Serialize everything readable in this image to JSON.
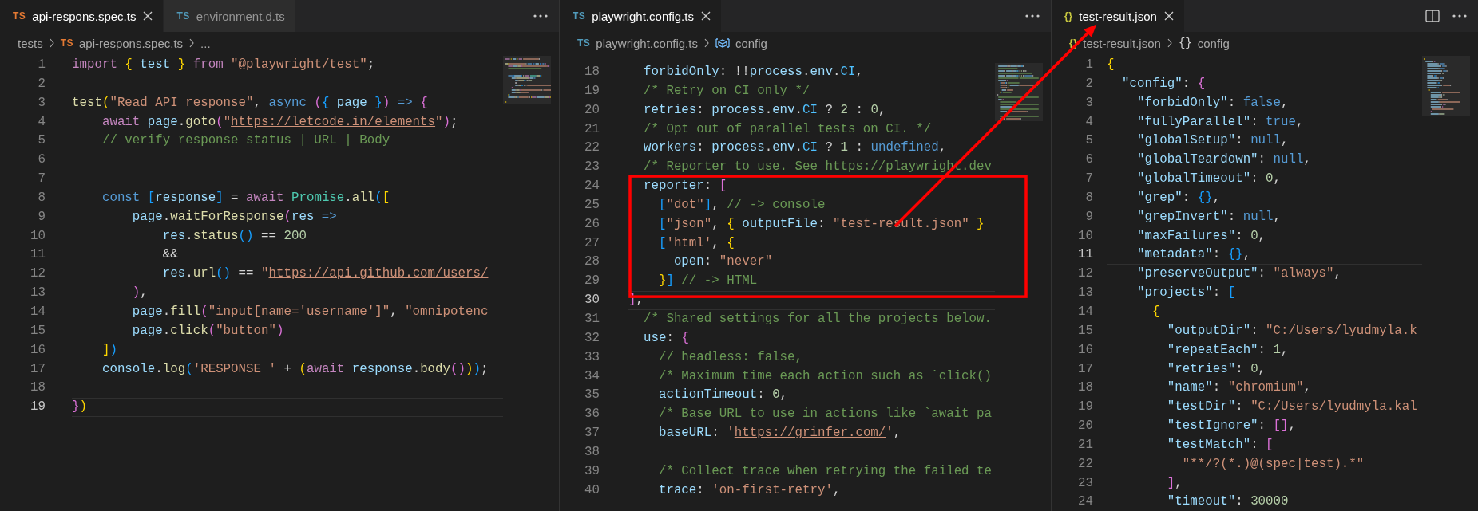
{
  "panes": [
    {
      "tabs": [
        {
          "label": "api-respons.spec.ts",
          "icon": "TS",
          "color": "#e37933",
          "selected": true
        },
        {
          "label": "environment.d.ts",
          "icon": "TS",
          "color": "#519aba",
          "selected": false
        }
      ],
      "actions": [
        {
          "kind": "more"
        }
      ],
      "breadcrumbs": [
        {
          "kind": "folder",
          "label": "tests"
        },
        {
          "kind": "file",
          "icon": "TS",
          "color": "#e37933",
          "label": "api-respons.spec.ts"
        },
        {
          "kind": "more",
          "label": "..."
        }
      ],
      "lines": [
        {
          "n": "1",
          "current": false,
          "tokens": [
            {
              "text": "import",
              "kind": "c"
            },
            {
              "text": " {",
              "kind": "b1"
            },
            {
              "text": " test ",
              "kind": "v"
            },
            {
              "text": "}",
              "kind": "b1"
            },
            {
              "text": " from",
              "kind": "c"
            },
            {
              "text": " \"@playwright/test\"",
              "kind": "s"
            },
            {
              "text": ";",
              "kind": "p"
            }
          ]
        },
        {
          "n": "2",
          "current": false
        },
        {
          "n": "3",
          "current": false,
          "tokens": [
            {
              "text": "test",
              "kind": "f"
            },
            {
              "text": "(",
              "kind": "b1"
            },
            {
              "text": "\"Read API response\"",
              "kind": "s"
            },
            {
              "text": ", ",
              "kind": "p"
            },
            {
              "text": "async",
              "kind": "k"
            },
            {
              "text": " (",
              "kind": "b2"
            },
            {
              "text": "{",
              "kind": "b3"
            },
            {
              "text": " page ",
              "kind": "v"
            },
            {
              "text": "}",
              "kind": "b3"
            },
            {
              "text": ")",
              "kind": "b2"
            },
            {
              "text": " => ",
              "kind": "k"
            },
            {
              "text": "{",
              "kind": "b2"
            }
          ]
        },
        {
          "n": "4",
          "current": false,
          "tokens": [
            {
              "text": "    await",
              "kind": "c"
            },
            {
              "text": " page",
              "kind": "v"
            },
            {
              "text": ".",
              "kind": "p"
            },
            {
              "text": "goto",
              "kind": "f"
            },
            {
              "text": "(",
              "kind": "b2"
            },
            {
              "text": "\"",
              "kind": "s"
            },
            {
              "text": "https://letcode.in/elements",
              "kind": "u"
            },
            {
              "text": "\"",
              "kind": "s"
            },
            {
              "text": ")",
              "kind": "b2"
            },
            {
              "text": ";",
              "kind": "p"
            }
          ]
        },
        {
          "n": "5",
          "current": false,
          "tokens": [
            {
              "text": "    // verify response status | URL | Body",
              "kind": "m"
            }
          ]
        },
        {
          "n": "6",
          "current": false
        },
        {
          "n": "7",
          "current": false
        },
        {
          "n": "8",
          "current": false,
          "tokens": [
            {
              "text": "    const",
              "kind": "k"
            },
            {
              "text": " [",
              "kind": "b3"
            },
            {
              "text": "response",
              "kind": "v"
            },
            {
              "text": "]",
              "kind": "b3"
            },
            {
              "text": " = ",
              "kind": "p"
            },
            {
              "text": "await",
              "kind": "c"
            },
            {
              "text": " Promise",
              "kind": "t"
            },
            {
              "text": ".",
              "kind": "p"
            },
            {
              "text": "all",
              "kind": "f"
            },
            {
              "text": "(",
              "kind": "b3"
            },
            {
              "text": "[",
              "kind": "b1"
            }
          ]
        },
        {
          "n": "9",
          "current": false,
          "tokens": [
            {
              "text": "        page",
              "kind": "v"
            },
            {
              "text": ".",
              "kind": "p"
            },
            {
              "text": "waitForResponse",
              "kind": "f"
            },
            {
              "text": "(",
              "kind": "b2"
            },
            {
              "text": "res",
              "kind": "v"
            },
            {
              "text": " =>",
              "kind": "k"
            }
          ]
        },
        {
          "n": "10",
          "current": false,
          "tokens": [
            {
              "text": "            res",
              "kind": "v"
            },
            {
              "text": ".",
              "kind": "p"
            },
            {
              "text": "status",
              "kind": "f"
            },
            {
              "text": "()",
              "kind": "b3"
            },
            {
              "text": " == ",
              "kind": "p"
            },
            {
              "text": "200",
              "kind": "n"
            }
          ]
        },
        {
          "n": "11",
          "current": false,
          "tokens": [
            {
              "text": "            &&",
              "kind": "p"
            }
          ]
        },
        {
          "n": "12",
          "current": false,
          "tokens": [
            {
              "text": "            res",
              "kind": "v"
            },
            {
              "text": ".",
              "kind": "p"
            },
            {
              "text": "url",
              "kind": "f"
            },
            {
              "text": "()",
              "kind": "b3"
            },
            {
              "text": " == ",
              "kind": "p"
            },
            {
              "text": "\"",
              "kind": "s"
            },
            {
              "text": "https://api.github.com/users/",
              "kind": "u"
            }
          ]
        },
        {
          "n": "13",
          "current": false,
          "tokens": [
            {
              "text": "        )",
              "kind": "b2"
            },
            {
              "text": ",",
              "kind": "p"
            }
          ]
        },
        {
          "n": "14",
          "current": false,
          "tokens": [
            {
              "text": "        page",
              "kind": "v"
            },
            {
              "text": ".",
              "kind": "p"
            },
            {
              "text": "fill",
              "kind": "f"
            },
            {
              "text": "(",
              "kind": "b2"
            },
            {
              "text": "\"input[name='username']\"",
              "kind": "s"
            },
            {
              "text": ", ",
              "kind": "p"
            },
            {
              "text": "\"omnipotenc",
              "kind": "s"
            }
          ]
        },
        {
          "n": "15",
          "current": false,
          "tokens": [
            {
              "text": "        page",
              "kind": "v"
            },
            {
              "text": ".",
              "kind": "p"
            },
            {
              "text": "click",
              "kind": "f"
            },
            {
              "text": "(",
              "kind": "b2"
            },
            {
              "text": "\"button\"",
              "kind": "s"
            },
            {
              "text": ")",
              "kind": "b2"
            }
          ]
        },
        {
          "n": "16",
          "current": false,
          "tokens": [
            {
              "text": "    ]",
              "kind": "b1"
            },
            {
              "text": ")",
              "kind": "b3"
            }
          ]
        },
        {
          "n": "17",
          "current": false,
          "tokens": [
            {
              "text": "    console",
              "kind": "v"
            },
            {
              "text": ".",
              "kind": "p"
            },
            {
              "text": "log",
              "kind": "f"
            },
            {
              "text": "(",
              "kind": "b3"
            },
            {
              "text": "'RESPONSE '",
              "kind": "s"
            },
            {
              "text": " + ",
              "kind": "p"
            },
            {
              "text": "(",
              "kind": "b1"
            },
            {
              "text": "await",
              "kind": "c"
            },
            {
              "text": " response",
              "kind": "v"
            },
            {
              "text": ".",
              "kind": "p"
            },
            {
              "text": "body",
              "kind": "f"
            },
            {
              "text": "()",
              "kind": "b2"
            },
            {
              "text": ")",
              "kind": "b1"
            },
            {
              "text": ")",
              "kind": "b3"
            },
            {
              "text": ";",
              "kind": "p"
            }
          ]
        },
        {
          "n": "18",
          "current": false
        },
        {
          "n": "19",
          "current": true,
          "tokens": [
            {
              "text": "}",
              "kind": "b2"
            },
            {
              "text": ")",
              "kind": "b1"
            }
          ]
        }
      ]
    },
    {
      "tabs": [
        {
          "label": "playwright.config.ts",
          "icon": "TS",
          "color": "#519aba",
          "selected": true
        }
      ],
      "actions": [
        {
          "kind": "more"
        }
      ],
      "breadcrumbs": [
        {
          "kind": "file",
          "icon": "TS",
          "color": "#519aba",
          "label": "playwright.config.ts"
        },
        {
          "kind": "symbol",
          "label": "config"
        }
      ],
      "lines": [
        {
          "n": "18",
          "current": false,
          "tokens": [
            {
              "text": "  forbidOnly",
              "kind": "v"
            },
            {
              "text": ": !!",
              "kind": "p"
            },
            {
              "text": "process",
              "kind": "v"
            },
            {
              "text": ".",
              "kind": "p"
            },
            {
              "text": "env",
              "kind": "v"
            },
            {
              "text": ".",
              "kind": "p"
            },
            {
              "text": "CI",
              "kind": "C"
            },
            {
              "text": ",",
              "kind": "p"
            }
          ]
        },
        {
          "n": "19",
          "current": false,
          "tokens": [
            {
              "text": "  /* Retry on CI only */",
              "kind": "m"
            }
          ]
        },
        {
          "n": "20",
          "current": false,
          "tokens": [
            {
              "text": "  retries",
              "kind": "v"
            },
            {
              "text": ": ",
              "kind": "p"
            },
            {
              "text": "process",
              "kind": "v"
            },
            {
              "text": ".",
              "kind": "p"
            },
            {
              "text": "env",
              "kind": "v"
            },
            {
              "text": ".",
              "kind": "p"
            },
            {
              "text": "CI",
              "kind": "C"
            },
            {
              "text": " ? ",
              "kind": "p"
            },
            {
              "text": "2",
              "kind": "n"
            },
            {
              "text": " : ",
              "kind": "p"
            },
            {
              "text": "0",
              "kind": "n"
            },
            {
              "text": ",",
              "kind": "p"
            }
          ]
        },
        {
          "n": "21",
          "current": false,
          "tokens": [
            {
              "text": "  /* Opt out of parallel tests on CI. */",
              "kind": "m"
            }
          ]
        },
        {
          "n": "22",
          "current": false,
          "tokens": [
            {
              "text": "  workers",
              "kind": "v"
            },
            {
              "text": ": ",
              "kind": "p"
            },
            {
              "text": "process",
              "kind": "v"
            },
            {
              "text": ".",
              "kind": "p"
            },
            {
              "text": "env",
              "kind": "v"
            },
            {
              "text": ".",
              "kind": "p"
            },
            {
              "text": "CI",
              "kind": "C"
            },
            {
              "text": " ? ",
              "kind": "p"
            },
            {
              "text": "1",
              "kind": "n"
            },
            {
              "text": " : ",
              "kind": "p"
            },
            {
              "text": "undefined",
              "kind": "k"
            },
            {
              "text": ",",
              "kind": "p"
            }
          ]
        },
        {
          "n": "23",
          "current": false,
          "tokens": [
            {
              "text": "  /* Reporter to use. See ",
              "kind": "m"
            },
            {
              "text": "https://playwright.dev",
              "kind": "mu"
            }
          ]
        },
        {
          "n": "24",
          "current": false,
          "tokens": [
            {
              "text": "  reporter",
              "kind": "v"
            },
            {
              "text": ": ",
              "kind": "p"
            },
            {
              "text": "[",
              "kind": "b2"
            }
          ]
        },
        {
          "n": "25",
          "current": false,
          "tokens": [
            {
              "text": "    [",
              "kind": "b3"
            },
            {
              "text": "\"dot\"",
              "kind": "s"
            },
            {
              "text": "]",
              "kind": "b3"
            },
            {
              "text": ", ",
              "kind": "p"
            },
            {
              "text": "// -> console",
              "kind": "m"
            }
          ]
        },
        {
          "n": "26",
          "current": false,
          "tokens": [
            {
              "text": "    [",
              "kind": "b3"
            },
            {
              "text": "\"json\"",
              "kind": "s"
            },
            {
              "text": ", ",
              "kind": "p"
            },
            {
              "text": "{",
              "kind": "b1"
            },
            {
              "text": " outputFile",
              "kind": "v"
            },
            {
              "text": ": ",
              "kind": "p"
            },
            {
              "text": "\"test-result.json\"",
              "kind": "s"
            },
            {
              "text": " }",
              "kind": "b1"
            }
          ]
        },
        {
          "n": "27",
          "current": false,
          "tokens": [
            {
              "text": "    [",
              "kind": "b3"
            },
            {
              "text": "'html'",
              "kind": "s"
            },
            {
              "text": ", ",
              "kind": "p"
            },
            {
              "text": "{",
              "kind": "b1"
            }
          ]
        },
        {
          "n": "28",
          "current": false,
          "tokens": [
            {
              "text": "      open",
              "kind": "v"
            },
            {
              "text": ": ",
              "kind": "p"
            },
            {
              "text": "\"never\"",
              "kind": "s"
            }
          ]
        },
        {
          "n": "29",
          "current": false,
          "tokens": [
            {
              "text": "    }",
              "kind": "b1"
            },
            {
              "text": "]",
              "kind": "b3"
            },
            {
              "text": " // -> HTML",
              "kind": "m"
            }
          ]
        },
        {
          "n": "30",
          "current": true,
          "tokens": [
            {
              "text": "]",
              "kind": "b2"
            },
            {
              "text": ",",
              "kind": "p"
            }
          ]
        },
        {
          "n": "31",
          "current": false,
          "tokens": [
            {
              "text": "  /* Shared settings for all the projects below.",
              "kind": "m"
            }
          ]
        },
        {
          "n": "32",
          "current": false,
          "tokens": [
            {
              "text": "  use",
              "kind": "v"
            },
            {
              "text": ": ",
              "kind": "p"
            },
            {
              "text": "{",
              "kind": "b2"
            }
          ]
        },
        {
          "n": "33",
          "current": false,
          "tokens": [
            {
              "text": "    // headless: false,",
              "kind": "m"
            }
          ]
        },
        {
          "n": "34",
          "current": false,
          "tokens": [
            {
              "text": "    /* Maximum time each action such as `click()",
              "kind": "m"
            }
          ]
        },
        {
          "n": "35",
          "current": false,
          "tokens": [
            {
              "text": "    actionTimeout",
              "kind": "v"
            },
            {
              "text": ": ",
              "kind": "p"
            },
            {
              "text": "0",
              "kind": "n"
            },
            {
              "text": ",",
              "kind": "p"
            }
          ]
        },
        {
          "n": "36",
          "current": false,
          "tokens": [
            {
              "text": "    /* Base URL to use in actions like `await pa",
              "kind": "m"
            }
          ]
        },
        {
          "n": "37",
          "current": false,
          "tokens": [
            {
              "text": "    baseURL",
              "kind": "v"
            },
            {
              "text": ": ",
              "kind": "p"
            },
            {
              "text": "'",
              "kind": "s"
            },
            {
              "text": "https://grinfer.com/",
              "kind": "u"
            },
            {
              "text": "'",
              "kind": "s"
            },
            {
              "text": ",",
              "kind": "p"
            }
          ]
        },
        {
          "n": "38",
          "current": false
        },
        {
          "n": "39",
          "current": false,
          "tokens": [
            {
              "text": "    /* Collect trace when retrying the failed te",
              "kind": "m"
            }
          ]
        },
        {
          "n": "40",
          "current": false,
          "tokens": [
            {
              "text": "    trace",
              "kind": "v"
            },
            {
              "text": ": ",
              "kind": "p"
            },
            {
              "text": "'on-first-retry'",
              "kind": "s"
            },
            {
              "text": ",",
              "kind": "p"
            }
          ]
        }
      ]
    },
    {
      "tabs": [
        {
          "label": "test-result.json",
          "icon": "{}",
          "color": "#cbcb41",
          "selected": true
        }
      ],
      "actions": [
        {
          "kind": "split"
        },
        {
          "kind": "more"
        }
      ],
      "breadcrumbs": [
        {
          "kind": "file",
          "icon": "{}",
          "color": "#cbcb41",
          "label": "test-result.json"
        },
        {
          "kind": "object",
          "icon": "{}",
          "label": "config"
        }
      ],
      "lines": [
        {
          "n": "1",
          "current": false,
          "tokens": [
            {
              "text": "{",
              "kind": "b1"
            }
          ]
        },
        {
          "n": "2",
          "current": false,
          "tokens": [
            {
              "text": "  \"config\"",
              "kind": "v"
            },
            {
              "text": ": ",
              "kind": "p"
            },
            {
              "text": "{",
              "kind": "b2"
            }
          ]
        },
        {
          "n": "3",
          "current": false,
          "tokens": [
            {
              "text": "    \"forbidOnly\"",
              "kind": "v"
            },
            {
              "text": ": ",
              "kind": "p"
            },
            {
              "text": "false",
              "kind": "k"
            },
            {
              "text": ",",
              "kind": "p"
            }
          ]
        },
        {
          "n": "4",
          "current": false,
          "tokens": [
            {
              "text": "    \"fullyParallel\"",
              "kind": "v"
            },
            {
              "text": ": ",
              "kind": "p"
            },
            {
              "text": "true",
              "kind": "k"
            },
            {
              "text": ",",
              "kind": "p"
            }
          ]
        },
        {
          "n": "5",
          "current": false,
          "tokens": [
            {
              "text": "    \"globalSetup\"",
              "kind": "v"
            },
            {
              "text": ": ",
              "kind": "p"
            },
            {
              "text": "null",
              "kind": "k"
            },
            {
              "text": ",",
              "kind": "p"
            }
          ]
        },
        {
          "n": "6",
          "current": false,
          "tokens": [
            {
              "text": "    \"globalTeardown\"",
              "kind": "v"
            },
            {
              "text": ": ",
              "kind": "p"
            },
            {
              "text": "null",
              "kind": "k"
            },
            {
              "text": ",",
              "kind": "p"
            }
          ]
        },
        {
          "n": "7",
          "current": false,
          "tokens": [
            {
              "text": "    \"globalTimeout\"",
              "kind": "v"
            },
            {
              "text": ": ",
              "kind": "p"
            },
            {
              "text": "0",
              "kind": "n"
            },
            {
              "text": ",",
              "kind": "p"
            }
          ]
        },
        {
          "n": "8",
          "current": false,
          "tokens": [
            {
              "text": "    \"grep\"",
              "kind": "v"
            },
            {
              "text": ": ",
              "kind": "p"
            },
            {
              "text": "{}",
              "kind": "b3"
            },
            {
              "text": ",",
              "kind": "p"
            }
          ]
        },
        {
          "n": "9",
          "current": false,
          "tokens": [
            {
              "text": "    \"grepInvert\"",
              "kind": "v"
            },
            {
              "text": ": ",
              "kind": "p"
            },
            {
              "text": "null",
              "kind": "k"
            },
            {
              "text": ",",
              "kind": "p"
            }
          ]
        },
        {
          "n": "10",
          "current": false,
          "tokens": [
            {
              "text": "    \"maxFailures\"",
              "kind": "v"
            },
            {
              "text": ": ",
              "kind": "p"
            },
            {
              "text": "0",
              "kind": "n"
            },
            {
              "text": ",",
              "kind": "p"
            }
          ]
        },
        {
          "n": "11",
          "current": true,
          "tokens": [
            {
              "text": "    \"metadata\"",
              "kind": "v"
            },
            {
              "text": ": ",
              "kind": "p"
            },
            {
              "text": "{}",
              "kind": "b3"
            },
            {
              "text": ",",
              "kind": "p"
            }
          ]
        },
        {
          "n": "12",
          "current": false,
          "tokens": [
            {
              "text": "    \"preserveOutput\"",
              "kind": "v"
            },
            {
              "text": ": ",
              "kind": "p"
            },
            {
              "text": "\"always\"",
              "kind": "s"
            },
            {
              "text": ",",
              "kind": "p"
            }
          ]
        },
        {
          "n": "13",
          "current": false,
          "tokens": [
            {
              "text": "    \"projects\"",
              "kind": "v"
            },
            {
              "text": ": ",
              "kind": "p"
            },
            {
              "text": "[",
              "kind": "b3"
            }
          ]
        },
        {
          "n": "14",
          "current": false,
          "tokens": [
            {
              "text": "      {",
              "kind": "b1"
            }
          ]
        },
        {
          "n": "15",
          "current": false,
          "tokens": [
            {
              "text": "        \"outputDir\"",
              "kind": "v"
            },
            {
              "text": ": ",
              "kind": "p"
            },
            {
              "text": "\"C:/Users/lyudmyla.k",
              "kind": "s"
            }
          ]
        },
        {
          "n": "16",
          "current": false,
          "tokens": [
            {
              "text": "        \"repeatEach\"",
              "kind": "v"
            },
            {
              "text": ": ",
              "kind": "p"
            },
            {
              "text": "1",
              "kind": "n"
            },
            {
              "text": ",",
              "kind": "p"
            }
          ]
        },
        {
          "n": "17",
          "current": false,
          "tokens": [
            {
              "text": "        \"retries\"",
              "kind": "v"
            },
            {
              "text": ": ",
              "kind": "p"
            },
            {
              "text": "0",
              "kind": "n"
            },
            {
              "text": ",",
              "kind": "p"
            }
          ]
        },
        {
          "n": "18",
          "current": false,
          "tokens": [
            {
              "text": "        \"name\"",
              "kind": "v"
            },
            {
              "text": ": ",
              "kind": "p"
            },
            {
              "text": "\"chromium\"",
              "kind": "s"
            },
            {
              "text": ",",
              "kind": "p"
            }
          ]
        },
        {
          "n": "19",
          "current": false,
          "tokens": [
            {
              "text": "        \"testDir\"",
              "kind": "v"
            },
            {
              "text": ": ",
              "kind": "p"
            },
            {
              "text": "\"C:/Users/lyudmyla.kal",
              "kind": "s"
            }
          ]
        },
        {
          "n": "20",
          "current": false,
          "tokens": [
            {
              "text": "        \"testIgnore\"",
              "kind": "v"
            },
            {
              "text": ": ",
              "kind": "p"
            },
            {
              "text": "[]",
              "kind": "b2"
            },
            {
              "text": ",",
              "kind": "p"
            }
          ]
        },
        {
          "n": "21",
          "current": false,
          "tokens": [
            {
              "text": "        \"testMatch\"",
              "kind": "v"
            },
            {
              "text": ": ",
              "kind": "p"
            },
            {
              "text": "[",
              "kind": "b2"
            }
          ]
        },
        {
          "n": "22",
          "current": false,
          "tokens": [
            {
              "text": "          \"**/?(*.)@(spec|test).*\"",
              "kind": "s"
            }
          ]
        },
        {
          "n": "23",
          "current": false,
          "tokens": [
            {
              "text": "        ]",
              "kind": "b2"
            },
            {
              "text": ",",
              "kind": "p"
            }
          ]
        },
        {
          "n": "24",
          "current": false,
          "tokens": [
            {
              "text": "        \"timeout\"",
              "kind": "v"
            },
            {
              "text": ": ",
              "kind": "p"
            },
            {
              "text": "30000",
              "kind": "n"
            }
          ]
        }
      ]
    }
  ],
  "annotation": {
    "kind": "box_with_arrow"
  }
}
